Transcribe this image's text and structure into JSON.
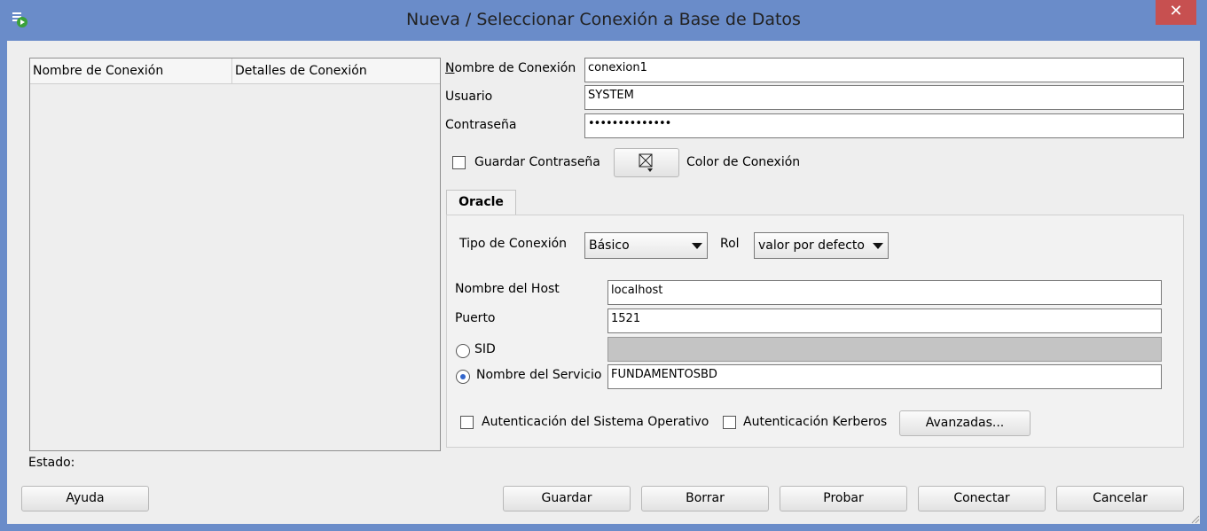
{
  "window": {
    "title": "Nueva / Seleccionar Conexión a Base de Datos",
    "close_glyph": "✕"
  },
  "connection_list": {
    "columns": [
      "Nombre de Conexión",
      "Detalles de Conexión"
    ],
    "rows": []
  },
  "status_label": "Estado:",
  "form": {
    "connection_name": {
      "label": "Nombre de Conexión",
      "value": "conexion1"
    },
    "user": {
      "label": "Usuario",
      "value": "SYSTEM"
    },
    "password": {
      "label": "Contraseña",
      "value": "••••••••••••••"
    },
    "save_password": {
      "label": "Guardar Contraseña",
      "checked": false
    },
    "connection_color": {
      "label": "Color de Conexión"
    }
  },
  "tabs": [
    {
      "label": "Oracle",
      "active": true
    }
  ],
  "oracle": {
    "connection_type": {
      "label": "Tipo de Conexión",
      "value": "Básico"
    },
    "role": {
      "label": "Rol",
      "value": "valor por defecto"
    },
    "host": {
      "label": "Nombre del Host",
      "value": "localhost"
    },
    "port": {
      "label": "Puerto",
      "value": "1521"
    },
    "sid": {
      "label": "SID",
      "value": "",
      "selected": false
    },
    "service_name": {
      "label": "Nombre del Servicio",
      "value": "FUNDAMENTOSBD",
      "selected": true
    },
    "os_auth": {
      "label": "Autenticación del Sistema Operativo",
      "checked": false
    },
    "kerberos_auth": {
      "label": "Autenticación Kerberos",
      "checked": false
    },
    "advanced_button": "Avanzadas..."
  },
  "buttons": {
    "help": "Ayuda",
    "save": "Guardar",
    "delete": "Borrar",
    "test": "Probar",
    "connect": "Conectar",
    "cancel": "Cancelar"
  },
  "icons": {
    "app": "database-connection-icon",
    "color": "color-picker-icon"
  }
}
